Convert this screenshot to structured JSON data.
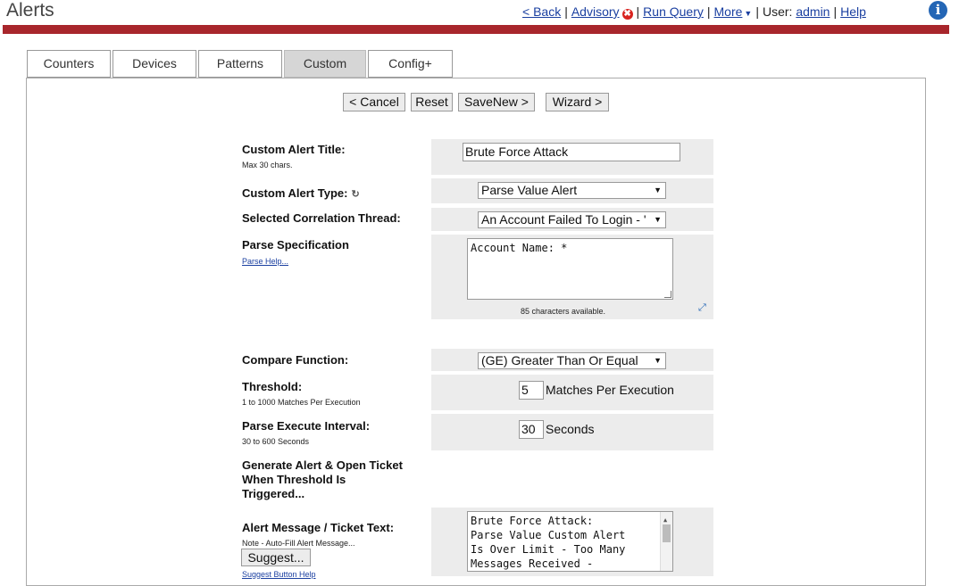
{
  "header": {
    "title": "Alerts",
    "nav": {
      "back": "< Back",
      "advisory": "Advisory",
      "advisory_badge": "✖",
      "run_query": "Run Query",
      "more": "More",
      "user_prefix": "User:",
      "user": "admin",
      "help": "Help"
    },
    "info_icon": "i"
  },
  "tabs": [
    "Counters",
    "Devices",
    "Patterns",
    "Custom",
    "Config+"
  ],
  "active_tab": "Custom",
  "toolbar": {
    "cancel": "< Cancel",
    "reset": "Reset",
    "save_new": "SaveNew >",
    "wizard": "Wizard >"
  },
  "form": {
    "title": {
      "label": "Custom Alert Title:",
      "hint": "Max 30 chars.",
      "value": "Brute Force Attack"
    },
    "type": {
      "label": "Custom Alert Type:",
      "value": "Parse Value Alert"
    },
    "thread": {
      "label": "Selected Correlation Thread:",
      "value": "An Account Failed To Login - '"
    },
    "parse_spec": {
      "label": "Parse Specification",
      "link": "Parse Help...",
      "value": "Account Name: *",
      "chars_available": "85 characters available."
    },
    "compare": {
      "label": "Compare Function:",
      "value": "(GE) Greater Than Or Equal"
    },
    "threshold": {
      "label": "Threshold:",
      "hint": "1 to 1000 Matches Per Execution",
      "value": "5",
      "unit": "Matches Per Execution"
    },
    "interval": {
      "label": "Parse Execute Interval:",
      "hint": "30 to 600 Seconds",
      "value": "30",
      "unit": "Seconds"
    },
    "generate": {
      "line1": "Generate Alert & Open Ticket",
      "line2": "When Threshold Is",
      "line3": "Triggered..."
    },
    "message": {
      "label": "Alert Message / Ticket Text:",
      "hint": "Note - Auto-Fill Alert Message...",
      "suggest": "Suggest...",
      "suggest_help": "Suggest Button Help",
      "value": "Brute Force Attack:\nParse Value Custom Alert\nIs Over Limit - Too Many\nMessages Received -"
    }
  }
}
